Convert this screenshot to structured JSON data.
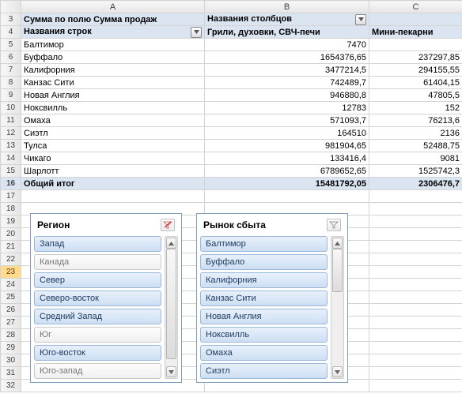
{
  "columns": {
    "A": "A",
    "B": "B",
    "C": "C"
  },
  "rowStart": 3,
  "rowEnd": 32,
  "selectedRow": 23,
  "pivot": {
    "measureLabel": "Сумма по полю Сумма продаж",
    "colLabelsHeader": "Названия столбцов",
    "rowLabelsHeader": "Названия строк",
    "col1": "Грили, духовки, СВЧ-печи",
    "col2": "Мини-пекарни",
    "rows": [
      {
        "label": "Балтимор",
        "v1": "7470",
        "v2": ""
      },
      {
        "label": "Буффало",
        "v1": "1654376,65",
        "v2": "237297,85"
      },
      {
        "label": "Калифорния",
        "v1": "3477214,5",
        "v2": "294155,55"
      },
      {
        "label": "Канзас Сити",
        "v1": "742489,7",
        "v2": "61404,15"
      },
      {
        "label": "Новая Англия",
        "v1": "946880,8",
        "v2": "47805,5"
      },
      {
        "label": "Ноксвилль",
        "v1": "12783",
        "v2": "152"
      },
      {
        "label": "Омаха",
        "v1": "571093,7",
        "v2": "76213,6"
      },
      {
        "label": "Сиэтл",
        "v1": "164510",
        "v2": "2136"
      },
      {
        "label": "Тулса",
        "v1": "981904,65",
        "v2": "52488,75"
      },
      {
        "label": "Чикаго",
        "v1": "133416,4",
        "v2": "9081"
      },
      {
        "label": "Шарлотт",
        "v1": "6789652,65",
        "v2": "1525742,3"
      }
    ],
    "totalLabel": "Общий итог",
    "totalV1": "15481792,05",
    "totalV2": "2306476,7"
  },
  "slicer1": {
    "title": "Регион",
    "items": [
      {
        "label": "Запад",
        "sel": true
      },
      {
        "label": "Канада",
        "sel": false
      },
      {
        "label": "Север",
        "sel": true
      },
      {
        "label": "Северо-восток",
        "sel": true
      },
      {
        "label": "Средний Запад",
        "sel": true
      },
      {
        "label": "Юг",
        "sel": false
      },
      {
        "label": "Юго-восток",
        "sel": true
      },
      {
        "label": "Юго-запад",
        "sel": false
      }
    ]
  },
  "slicer2": {
    "title": "Рынок сбыта",
    "items": [
      {
        "label": "Балтимор",
        "sel": true
      },
      {
        "label": "Буффало",
        "sel": true
      },
      {
        "label": "Калифорния",
        "sel": true
      },
      {
        "label": "Канзас Сити",
        "sel": true
      },
      {
        "label": "Новая Англия",
        "sel": true
      },
      {
        "label": "Ноксвилль",
        "sel": true
      },
      {
        "label": "Омаха",
        "sel": true
      },
      {
        "label": "Сиэтл",
        "sel": true
      }
    ]
  }
}
